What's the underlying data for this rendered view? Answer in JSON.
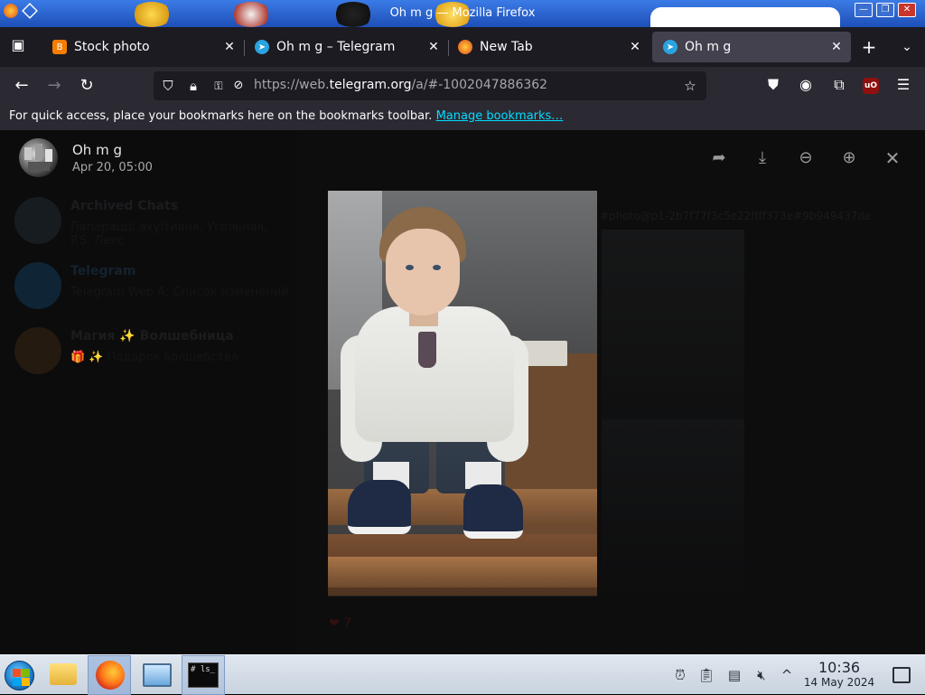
{
  "window": {
    "title": "Oh m g — Mozilla Firefox",
    "controls": [
      "minimize",
      "maximize",
      "close"
    ]
  },
  "tabs": [
    {
      "label": "Stock photo",
      "icon": "blogger-icon",
      "color": "#f57d00",
      "active": false
    },
    {
      "label": "Oh m g – Telegram",
      "icon": "telegram-icon",
      "color": "#2aa3e1",
      "active": false
    },
    {
      "label": "New Tab",
      "icon": "firefox-icon",
      "color": "#ff7139",
      "active": false
    },
    {
      "label": "Oh m g",
      "icon": "telegram-icon",
      "color": "#2aa3e1",
      "active": true
    }
  ],
  "navbar": {
    "url_prefix": "https://web.",
    "url_host": "telegram.org",
    "url_path": "/a/#-1002047886362"
  },
  "bookmarks": {
    "text": "For quick access, place your bookmarks here on the bookmarks toolbar.",
    "link": "Manage bookmarks…"
  },
  "viewer": {
    "sender": "Oh m g",
    "date": "Apr 20, 05:00",
    "actions": [
      "forward",
      "download",
      "zoom-out",
      "zoom-in",
      "close"
    ]
  },
  "background": {
    "chats": [
      {
        "name": "Archived Chats",
        "preview": "Папарацці ахуїтивна, Угольная, P.S. Лекс"
      },
      {
        "name": "Telegram",
        "preview": "Telegram Web A: Список изменений"
      },
      {
        "name": "Магия ✨ Волшебница",
        "preview": "🎁 ✨ Подарок волшебства"
      }
    ],
    "hash_text": "#photo@p1-2b7f77f3c5e22ffff373e#9b949437de",
    "reaction_count": "7"
  },
  "taskbar": {
    "time": "10:36",
    "date": "14 May 2024",
    "terminal_text": "# ls_"
  },
  "colors": {
    "telegram": "#2aa3e1",
    "link": "#00ddff",
    "tab_active": "#42414d",
    "tab_bar": "#1c1b22"
  }
}
